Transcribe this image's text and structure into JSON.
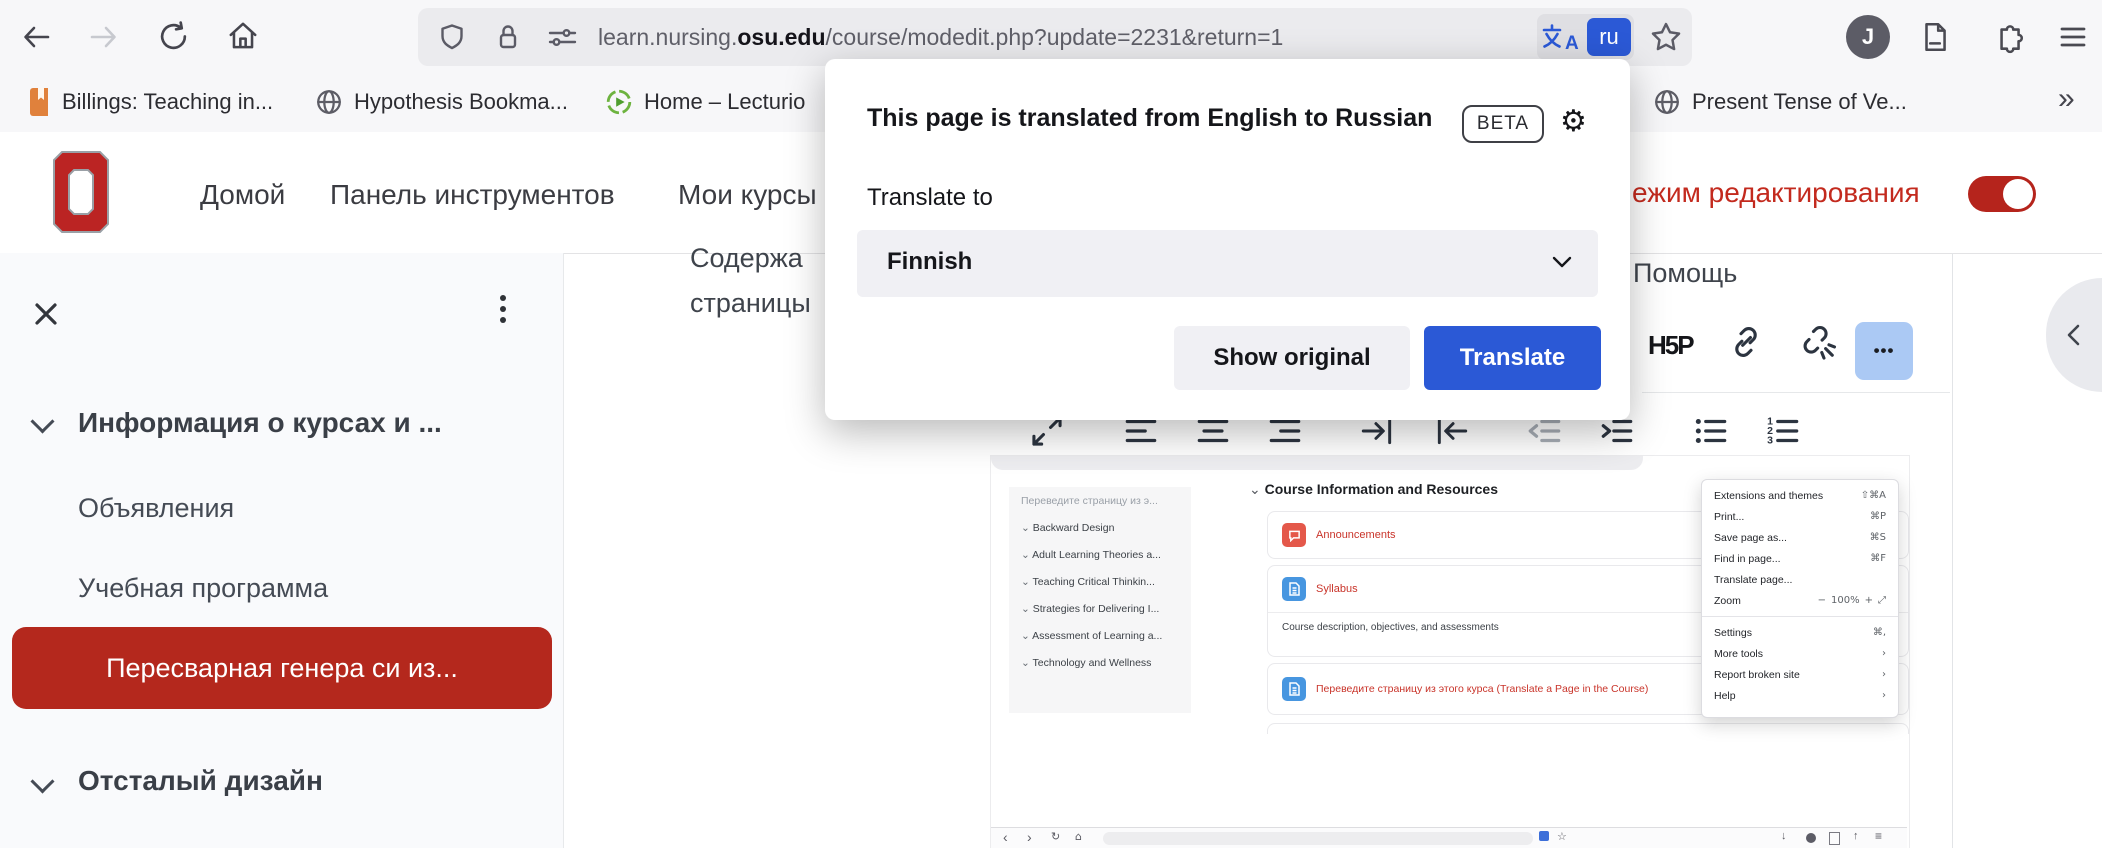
{
  "colors": {
    "accent_blue": "#2b59d6",
    "scarlet": "#ba2a1e",
    "pill_red": "#b4281d",
    "edit_red": "#c32a1e"
  },
  "chrome": {
    "url_prefix": "learn.nursing.",
    "url_domain": "osu.edu",
    "url_path": "/course/modedit.php?update=2231&return=1",
    "translate_lang_badge": "ru",
    "profile_initial": "J",
    "bookmarks_overflow": "»",
    "bookmarks": [
      {
        "label": "Billings: Teaching in...",
        "icon": "book-icon"
      },
      {
        "label": "Hypothesis Bookma...",
        "icon": "globe-icon"
      },
      {
        "label": "Home – Lecturio",
        "icon": "play-icon"
      },
      {
        "label": "Present Tense of Ve...",
        "icon": "globe-icon"
      }
    ]
  },
  "popup": {
    "title": "This page is translated from English to Russian",
    "beta_badge": "BETA",
    "translate_to_label": "Translate to",
    "selected_language": "Finnish",
    "show_original_label": "Show original",
    "translate_label": "Translate"
  },
  "site": {
    "nav": [
      "Домой",
      "Панель инструментов",
      "Мои курсы"
    ],
    "edit_mode_label": "ежим редактирования"
  },
  "sidebar": {
    "section1": "Информация о курсах и ...",
    "item1": "Объявления",
    "item2": "Учебная программа",
    "active_item": "Пересварная генера си из...",
    "section2": "Отсталый дизайн"
  },
  "page": {
    "content_line1": "Содержа",
    "content_line2": "страницы",
    "help_label": "Помощь",
    "h5p_label": "H5P",
    "more_dots": "•••"
  },
  "mini": {
    "sidebar": [
      "Переведите страницу из э...",
      "Backward Design",
      "Adult Learning Theories a...",
      "Teaching Critical Thinkin...",
      "Strategies for Delivering I...",
      "Assessment of Learning a...",
      "Technology and Wellness"
    ],
    "section_title": "Course Information and Resources",
    "card1_label": "Announcements",
    "card2_label": "Syllabus",
    "card2_desc": "Course description, objectives, and assessments",
    "card3_label": "Переведите страницу из этого курса (Translate a Page in the Course)",
    "menu": [
      {
        "label": "Extensions and themes",
        "shortcut": "⇧⌘A"
      },
      {
        "label": "Print...",
        "shortcut": "⌘P"
      },
      {
        "label": "Save page as...",
        "shortcut": "⌘S"
      },
      {
        "label": "Find in page...",
        "shortcut": "⌘F"
      },
      {
        "label": "Translate page...",
        "shortcut": ""
      },
      {
        "label": "Zoom",
        "shortcut": "− 100% + ⤢"
      },
      {
        "label": "Settings",
        "shortcut": "⌘,"
      },
      {
        "label": "More tools",
        "shortcut": "›"
      },
      {
        "label": "Report broken site",
        "shortcut": "›"
      },
      {
        "label": "Help",
        "shortcut": "›"
      }
    ]
  }
}
